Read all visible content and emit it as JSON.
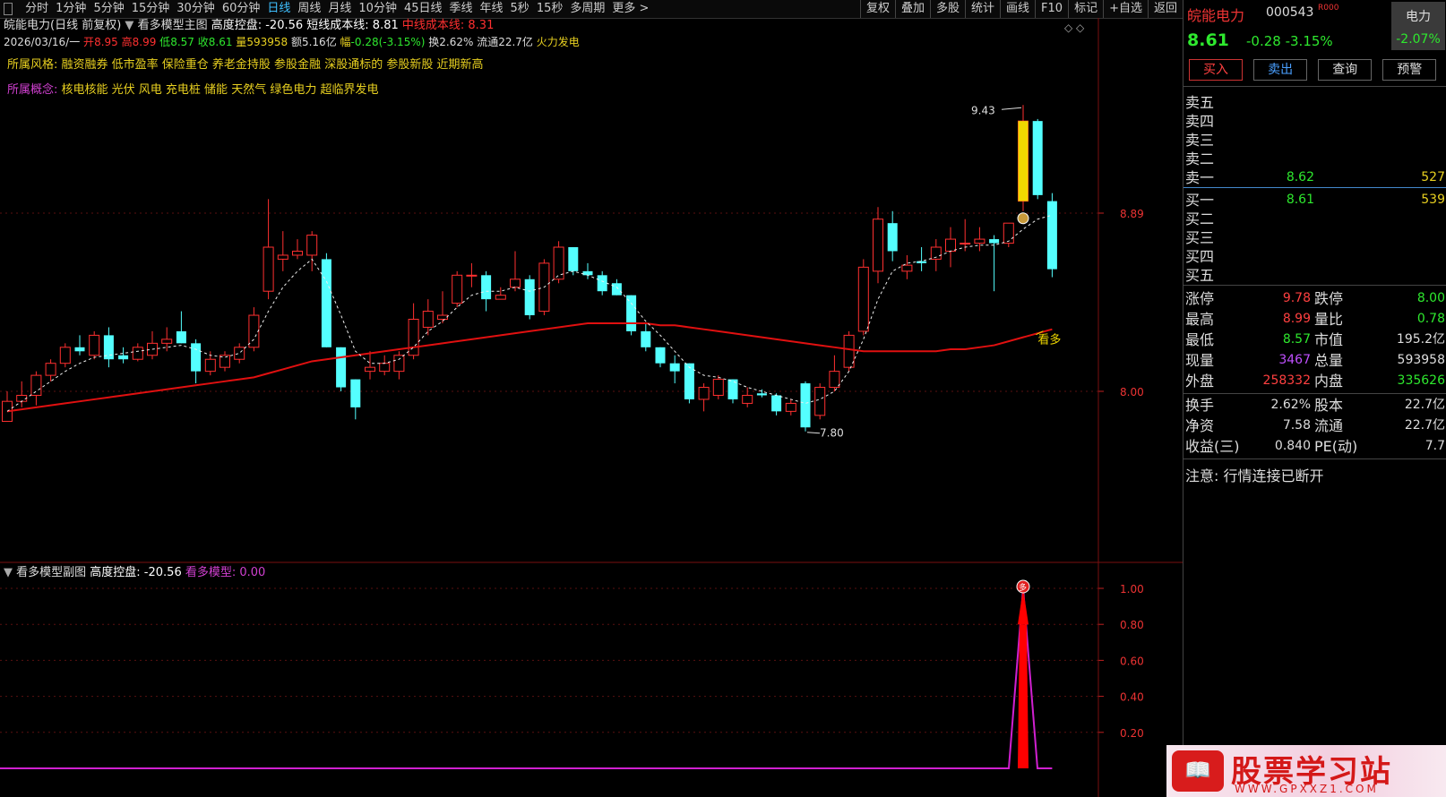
{
  "toolbar": {
    "periods": [
      "分时",
      "1分钟",
      "5分钟",
      "15分钟",
      "30分钟",
      "60分钟",
      "日线",
      "周线",
      "月线",
      "10分钟",
      "45日线",
      "季线",
      "年线",
      "5秒",
      "15秒",
      "多周期",
      "更多 >"
    ],
    "active_period_index": 6,
    "tools": [
      "复权",
      "叠加",
      "多股",
      "统计",
      "画线",
      "F10",
      "标记",
      "+自选",
      "返回"
    ]
  },
  "chart_header": {
    "title": "皖能电力(日线 前复权)",
    "indicator_name": "看多模型主图",
    "gaodu_label": "高度控盘: -20.56",
    "short_cost": "短线成本线: 8.81",
    "mid_cost": "中线成本线: 8.31",
    "date": "2026/03/16/一",
    "open_label": "开",
    "open": "8.95",
    "high_label": "高",
    "high": "8.99",
    "low_label": "低",
    "low": "8.57",
    "close_label": "收",
    "close": "8.61",
    "volume_label": "量",
    "volume": "593958",
    "amount_label": "额",
    "amount": "5.16亿",
    "change_label": "幅",
    "change": "-0.28(-3.15%)",
    "turnover": "换2.62%",
    "float": "流通22.7亿",
    "sector": "火力发电",
    "style_label": "所属风格:",
    "style": "融资融券 低市盈率 保险重仓 养老金持股 参股金融 深股通标的 参股新股 近期新高",
    "concept_label": "所属概念:",
    "concept": "核电核能 光伏 风电 充电桩 储能 天然气 绿色电力 超临界发电",
    "diamonds": "◇ ◇"
  },
  "chart_data": {
    "type": "candlestick",
    "y_ticks": [
      8.0,
      8.89
    ],
    "ylim": [
      7.5,
      9.65
    ],
    "annotations": {
      "high_mark": "9.43",
      "low_mark": "7.80",
      "signal_text": "看多"
    },
    "candles": [
      {
        "o": 7.85,
        "h": 8.0,
        "l": 7.85,
        "c": 7.95
      },
      {
        "o": 7.95,
        "h": 8.05,
        "l": 7.92,
        "c": 7.98
      },
      {
        "o": 7.98,
        "h": 8.1,
        "l": 7.93,
        "c": 8.08
      },
      {
        "o": 8.08,
        "h": 8.16,
        "l": 8.05,
        "c": 8.14
      },
      {
        "o": 8.14,
        "h": 8.24,
        "l": 8.12,
        "c": 8.22
      },
      {
        "o": 8.22,
        "h": 8.28,
        "l": 8.18,
        "c": 8.2
      },
      {
        "o": 8.18,
        "h": 8.3,
        "l": 8.16,
        "c": 8.28
      },
      {
        "o": 8.28,
        "h": 8.32,
        "l": 8.12,
        "c": 8.16
      },
      {
        "o": 8.18,
        "h": 8.22,
        "l": 8.14,
        "c": 8.16
      },
      {
        "o": 8.16,
        "h": 8.24,
        "l": 8.15,
        "c": 8.22
      },
      {
        "o": 8.18,
        "h": 8.3,
        "l": 8.16,
        "c": 8.24
      },
      {
        "o": 8.24,
        "h": 8.32,
        "l": 8.2,
        "c": 8.26
      },
      {
        "o": 8.3,
        "h": 8.4,
        "l": 8.24,
        "c": 8.24
      },
      {
        "o": 8.24,
        "h": 8.26,
        "l": 8.04,
        "c": 8.1
      },
      {
        "o": 8.1,
        "h": 8.2,
        "l": 8.08,
        "c": 8.16
      },
      {
        "o": 8.12,
        "h": 8.2,
        "l": 8.1,
        "c": 8.18
      },
      {
        "o": 8.16,
        "h": 8.24,
        "l": 8.14,
        "c": 8.22
      },
      {
        "o": 8.22,
        "h": 8.42,
        "l": 8.2,
        "c": 8.38
      },
      {
        "o": 8.5,
        "h": 8.96,
        "l": 8.46,
        "c": 8.72
      },
      {
        "o": 8.66,
        "h": 8.8,
        "l": 8.6,
        "c": 8.68
      },
      {
        "o": 8.68,
        "h": 8.76,
        "l": 8.66,
        "c": 8.7
      },
      {
        "o": 8.68,
        "h": 8.8,
        "l": 8.6,
        "c": 8.78
      },
      {
        "o": 8.66,
        "h": 8.69,
        "l": 8.22,
        "c": 8.22
      },
      {
        "o": 8.22,
        "h": 8.22,
        "l": 8.0,
        "c": 8.02
      },
      {
        "o": 8.06,
        "h": 8.06,
        "l": 7.86,
        "c": 7.92
      },
      {
        "o": 8.1,
        "h": 8.2,
        "l": 8.06,
        "c": 8.12
      },
      {
        "o": 8.1,
        "h": 8.18,
        "l": 8.08,
        "c": 8.14
      },
      {
        "o": 8.1,
        "h": 8.2,
        "l": 8.06,
        "c": 8.18
      },
      {
        "o": 8.18,
        "h": 8.44,
        "l": 8.16,
        "c": 8.36
      },
      {
        "o": 8.32,
        "h": 8.46,
        "l": 8.28,
        "c": 8.4
      },
      {
        "o": 8.36,
        "h": 8.5,
        "l": 8.34,
        "c": 8.38
      },
      {
        "o": 8.44,
        "h": 8.6,
        "l": 8.42,
        "c": 8.58
      },
      {
        "o": 8.58,
        "h": 8.64,
        "l": 8.52,
        "c": 8.58
      },
      {
        "o": 8.58,
        "h": 8.6,
        "l": 8.4,
        "c": 8.46
      },
      {
        "o": 8.46,
        "h": 8.52,
        "l": 8.46,
        "c": 8.48
      },
      {
        "o": 8.52,
        "h": 8.7,
        "l": 8.5,
        "c": 8.56
      },
      {
        "o": 8.56,
        "h": 8.58,
        "l": 8.36,
        "c": 8.38
      },
      {
        "o": 8.4,
        "h": 8.66,
        "l": 8.38,
        "c": 8.64
      },
      {
        "o": 8.56,
        "h": 8.75,
        "l": 8.54,
        "c": 8.72
      },
      {
        "o": 8.72,
        "h": 8.72,
        "l": 8.58,
        "c": 8.6
      },
      {
        "o": 8.6,
        "h": 8.64,
        "l": 8.56,
        "c": 8.58
      },
      {
        "o": 8.58,
        "h": 8.6,
        "l": 8.48,
        "c": 8.5
      },
      {
        "o": 8.54,
        "h": 8.56,
        "l": 8.48,
        "c": 8.48
      },
      {
        "o": 8.48,
        "h": 8.48,
        "l": 8.28,
        "c": 8.3
      },
      {
        "o": 8.3,
        "h": 8.34,
        "l": 8.2,
        "c": 8.22
      },
      {
        "o": 8.22,
        "h": 8.22,
        "l": 8.12,
        "c": 8.14
      },
      {
        "o": 8.14,
        "h": 8.18,
        "l": 8.04,
        "c": 8.1
      },
      {
        "o": 8.14,
        "h": 8.14,
        "l": 7.94,
        "c": 7.96
      },
      {
        "o": 7.96,
        "h": 8.04,
        "l": 7.9,
        "c": 8.02
      },
      {
        "o": 7.98,
        "h": 8.08,
        "l": 7.96,
        "c": 8.06
      },
      {
        "o": 8.06,
        "h": 8.06,
        "l": 7.94,
        "c": 7.96
      },
      {
        "o": 7.94,
        "h": 8.02,
        "l": 7.92,
        "c": 7.98
      },
      {
        "o": 7.99,
        "h": 8.01,
        "l": 7.97,
        "c": 7.98
      },
      {
        "o": 7.98,
        "h": 7.99,
        "l": 7.88,
        "c": 7.9
      },
      {
        "o": 7.9,
        "h": 7.96,
        "l": 7.88,
        "c": 7.94
      },
      {
        "o": 8.04,
        "h": 8.05,
        "l": 7.8,
        "c": 7.82
      },
      {
        "o": 7.88,
        "h": 8.04,
        "l": 7.86,
        "c": 8.02
      },
      {
        "o": 8.02,
        "h": 8.18,
        "l": 8.0,
        "c": 8.1
      },
      {
        "o": 8.12,
        "h": 8.3,
        "l": 8.1,
        "c": 8.28
      },
      {
        "o": 8.3,
        "h": 8.66,
        "l": 8.28,
        "c": 8.62
      },
      {
        "o": 8.6,
        "h": 8.92,
        "l": 8.54,
        "c": 8.86
      },
      {
        "o": 8.84,
        "h": 8.9,
        "l": 8.65,
        "c": 8.7
      },
      {
        "o": 8.6,
        "h": 8.68,
        "l": 8.56,
        "c": 8.63
      },
      {
        "o": 8.65,
        "h": 8.72,
        "l": 8.6,
        "c": 8.64
      },
      {
        "o": 8.66,
        "h": 8.76,
        "l": 8.6,
        "c": 8.72
      },
      {
        "o": 8.7,
        "h": 8.82,
        "l": 8.62,
        "c": 8.76
      },
      {
        "o": 8.74,
        "h": 8.86,
        "l": 8.7,
        "c": 8.74
      },
      {
        "o": 8.74,
        "h": 8.82,
        "l": 8.7,
        "c": 8.76
      },
      {
        "o": 8.76,
        "h": 8.78,
        "l": 8.5,
        "c": 8.74
      },
      {
        "o": 8.74,
        "h": 8.84,
        "l": 8.72,
        "c": 8.84
      },
      {
        "o": 8.95,
        "h": 9.43,
        "l": 8.9,
        "c": 9.35
      },
      {
        "o": 9.35,
        "h": 9.36,
        "l": 8.96,
        "c": 8.98
      },
      {
        "o": 8.95,
        "h": 8.99,
        "l": 8.57,
        "c": 8.61
      }
    ],
    "ma_long": [
      7.9,
      7.91,
      7.92,
      7.93,
      7.94,
      7.95,
      7.96,
      7.97,
      7.98,
      7.99,
      8.0,
      8.01,
      8.02,
      8.03,
      8.04,
      8.05,
      8.06,
      8.07,
      8.09,
      8.11,
      8.13,
      8.15,
      8.16,
      8.17,
      8.18,
      8.19,
      8.2,
      8.21,
      8.22,
      8.23,
      8.24,
      8.25,
      8.26,
      8.27,
      8.28,
      8.29,
      8.3,
      8.31,
      8.32,
      8.33,
      8.34,
      8.34,
      8.34,
      8.34,
      8.34,
      8.33,
      8.33,
      8.32,
      8.31,
      8.3,
      8.29,
      8.28,
      8.27,
      8.26,
      8.25,
      8.24,
      8.23,
      8.22,
      8.21,
      8.2,
      8.2,
      8.2,
      8.2,
      8.2,
      8.2,
      8.21,
      8.21,
      8.22,
      8.23,
      8.25,
      8.27,
      8.29,
      8.31
    ],
    "short_cost_values": [
      7.9,
      7.95,
      8.0,
      8.05,
      8.1,
      8.14,
      8.17,
      8.18,
      8.19,
      8.2,
      8.21,
      8.22,
      8.23,
      8.21,
      8.18,
      8.17,
      8.19,
      8.26,
      8.4,
      8.52,
      8.6,
      8.66,
      8.55,
      8.38,
      8.2,
      8.14,
      8.14,
      8.16,
      8.22,
      8.3,
      8.35,
      8.42,
      8.48,
      8.5,
      8.5,
      8.52,
      8.5,
      8.52,
      8.58,
      8.6,
      8.58,
      8.55,
      8.52,
      8.44,
      8.35,
      8.28,
      8.2,
      8.12,
      8.08,
      8.07,
      8.05,
      8.02,
      8.0,
      7.98,
      7.96,
      7.94,
      7.96,
      8.0,
      8.1,
      8.26,
      8.46,
      8.6,
      8.64,
      8.65,
      8.67,
      8.7,
      8.72,
      8.73,
      8.73,
      8.75,
      8.81,
      8.86,
      8.88
    ],
    "sub": {
      "title": "看多模型副图",
      "gaodu": "高度控盘: -20.56",
      "model_label": "看多模型: ",
      "model_value": "0.00",
      "y_ticks": [
        0.2,
        0.4,
        0.6,
        0.8,
        1.0
      ],
      "signal_index": 70,
      "signal_value": 1.0,
      "signal_marker": "多"
    }
  },
  "right_panel": {
    "name": "皖能电力",
    "code": "000543",
    "tag": "R000",
    "sector": "电力",
    "sector_change": "-2.07%",
    "price": "8.61",
    "change": "-0.28",
    "change_pct": "-3.15%",
    "buttons": [
      "买入",
      "卖出",
      "查询",
      "预警"
    ],
    "asks": [
      {
        "label": "卖五",
        "price": "",
        "vol": ""
      },
      {
        "label": "卖四",
        "price": "",
        "vol": ""
      },
      {
        "label": "卖三",
        "price": "",
        "vol": ""
      },
      {
        "label": "卖二",
        "price": "",
        "vol": ""
      },
      {
        "label": "卖一",
        "price": "8.62",
        "vol": "527"
      }
    ],
    "bids": [
      {
        "label": "买一",
        "price": "8.61",
        "vol": "539"
      },
      {
        "label": "买二",
        "price": "",
        "vol": ""
      },
      {
        "label": "买三",
        "price": "",
        "vol": ""
      },
      {
        "label": "买四",
        "price": "",
        "vol": ""
      },
      {
        "label": "买五",
        "price": "",
        "vol": ""
      }
    ],
    "stats1": [
      {
        "l1": "涨停",
        "v1": "9.78",
        "c1": "#ff4040",
        "l2": "跌停",
        "v2": "8.00",
        "c2": "#2ee82e"
      },
      {
        "l1": "最高",
        "v1": "8.99",
        "c1": "#ff4040",
        "l2": "量比",
        "v2": "0.78",
        "c2": "#2ee82e"
      },
      {
        "l1": "最低",
        "v1": "8.57",
        "c1": "#2ee82e",
        "l2": "市值",
        "v2": "195.2亿",
        "c2": "#dddddd"
      },
      {
        "l1": "现量",
        "v1": "3467",
        "c1": "#c050ff",
        "l2": "总量",
        "v2": "593958",
        "c2": "#dddddd"
      },
      {
        "l1": "外盘",
        "v1": "258332",
        "c1": "#ff4040",
        "l2": "内盘",
        "v2": "335626",
        "c2": "#2ee82e"
      }
    ],
    "stats2": [
      {
        "l1": "换手",
        "v1": "2.62%",
        "c1": "#dddddd",
        "l2": "股本",
        "v2": "22.7亿",
        "c2": "#dddddd"
      },
      {
        "l1": "净资",
        "v1": "7.58",
        "c1": "#dddddd",
        "l2": "流通",
        "v2": "22.7亿",
        "c2": "#dddddd"
      },
      {
        "l1": "收益(三)",
        "v1": "0.840",
        "c1": "#dddddd",
        "l2": "PE(动)",
        "v2": "7.7",
        "c2": "#dddddd"
      }
    ],
    "notice": "注意: 行情连接已断开"
  },
  "watermark": {
    "badge": "📖",
    "text": "股票学习站",
    "url": "WWW.GPXXZ1.COM"
  },
  "colors": {
    "up": "#ff3030",
    "down": "#54ffff",
    "ma": "#e01010",
    "sub_line": "#d020d0",
    "signal": "#ff0000",
    "yellow": "#f0d800"
  }
}
